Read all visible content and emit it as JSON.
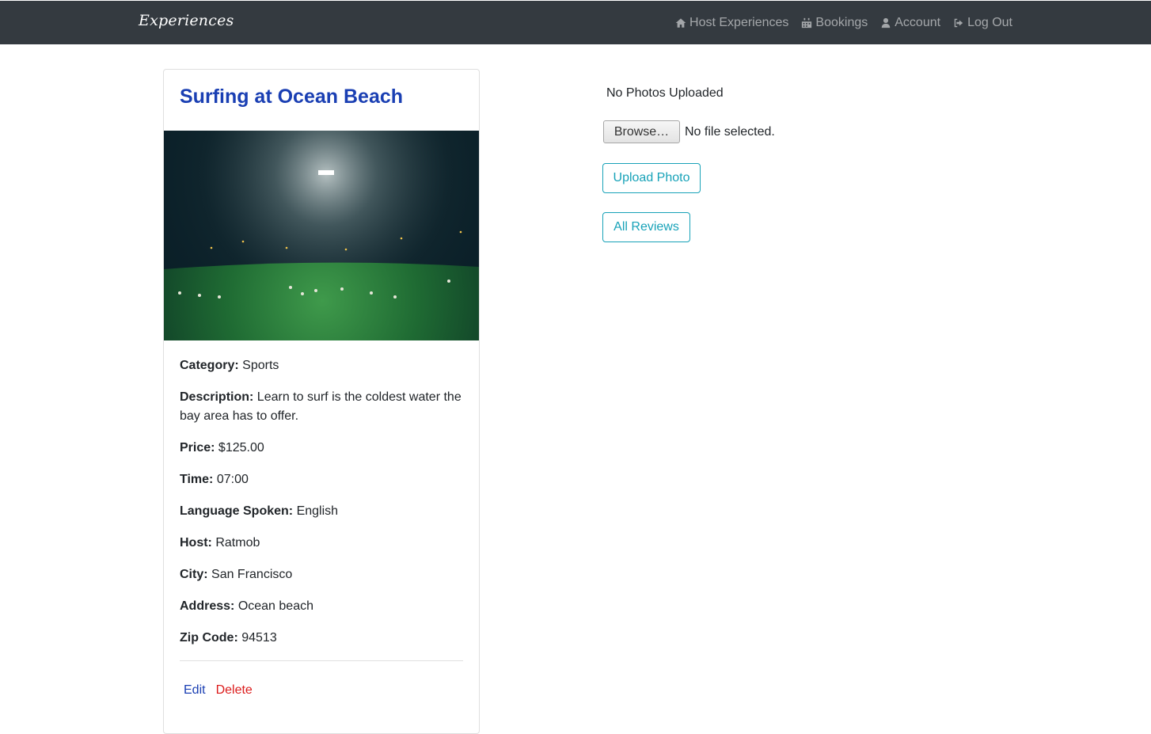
{
  "navbar": {
    "brand": "Experiences",
    "links": [
      {
        "label": "Host Experiences",
        "icon": "home-icon"
      },
      {
        "label": "Bookings",
        "icon": "calendar-icon"
      },
      {
        "label": "Account",
        "icon": "user-icon"
      },
      {
        "label": "Log Out",
        "icon": "sign-out-icon"
      }
    ]
  },
  "experience": {
    "title": "Surfing at Ocean Beach",
    "image": "night-field-photo",
    "fields": [
      {
        "label": "Category:",
        "value": "Sports"
      },
      {
        "label": "Description:",
        "value": "Learn to surf is the coldest water the bay area has to offer."
      },
      {
        "label": "Price:",
        "value": "$125.00"
      },
      {
        "label": "Time:",
        "value": "07:00"
      },
      {
        "label": "Language Spoken:",
        "value": "English"
      },
      {
        "label": "Host:",
        "value": "Ratmob"
      },
      {
        "label": "City:",
        "value": "San Francisco"
      },
      {
        "label": "Address:",
        "value": "Ocean beach"
      },
      {
        "label": "Zip Code:",
        "value": "94513"
      }
    ],
    "edit_label": "Edit",
    "delete_label": "Delete"
  },
  "photos": {
    "status": "No Photos Uploaded",
    "browse_label": "Browse…",
    "file_status": "No file selected.",
    "upload_label": "Upload Photo",
    "reviews_label": "All Reviews"
  },
  "colors": {
    "navbar": "#343a40",
    "title": "#1a3fb3",
    "delete": "#dc1c1c",
    "outline": "#17a2b8"
  }
}
